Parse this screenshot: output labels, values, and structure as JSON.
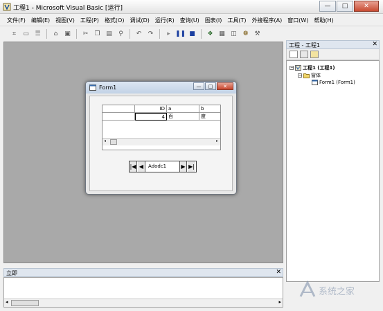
{
  "app": {
    "title": "工程1 - Microsoft Visual Basic [运行]"
  },
  "window_controls": {
    "minimize": "—",
    "maximize": "□",
    "close": "✕"
  },
  "menu": {
    "items": [
      "文件(F)",
      "编辑(E)",
      "视图(V)",
      "工程(P)",
      "格式(O)",
      "调试(D)",
      "运行(R)",
      "查询(U)",
      "图表(I)",
      "工具(T)",
      "外接程序(A)",
      "窗口(W)",
      "帮助(H)"
    ]
  },
  "toolbar": {
    "icons": [
      "add-project-icon",
      "add-form-icon",
      "menu-editor-icon",
      "open-icon",
      "save-icon",
      "cut-icon",
      "copy-icon",
      "paste-icon",
      "find-icon",
      "undo-icon",
      "redo-icon",
      "start-icon",
      "break-icon",
      "end-icon",
      "project-explorer-icon",
      "properties-icon",
      "form-layout-icon",
      "object-browser-icon",
      "toolbox-icon"
    ]
  },
  "project_explorer": {
    "title": "工程 - 工程1",
    "close": "✕",
    "tree": [
      {
        "label": "工程1 (工程1)",
        "toggle": "⊟"
      },
      {
        "label": "窗体",
        "toggle": "⊟"
      },
      {
        "label": "Form1 (Form1)"
      }
    ]
  },
  "form1": {
    "title": "Form1",
    "grid": {
      "headers": [
        "",
        "ID",
        "a",
        "b"
      ],
      "rows": [
        [
          "",
          "4",
          "百",
          "度"
        ]
      ]
    },
    "scroll_left": "◂",
    "scroll_right": "▸",
    "adodc": {
      "caption": "Adodc1",
      "first": "|◀",
      "prev": "◀",
      "next": "▶",
      "last": "▶|"
    }
  },
  "immediate": {
    "title": "立即",
    "close": "✕",
    "scroll_left": "◂",
    "scroll_right": "▸"
  },
  "watermark": {
    "text": "系统之家"
  },
  "colors": {
    "workspace": "#a9a9a9",
    "title_accent": "#dfe6ef",
    "close_red": "#c84b31"
  }
}
